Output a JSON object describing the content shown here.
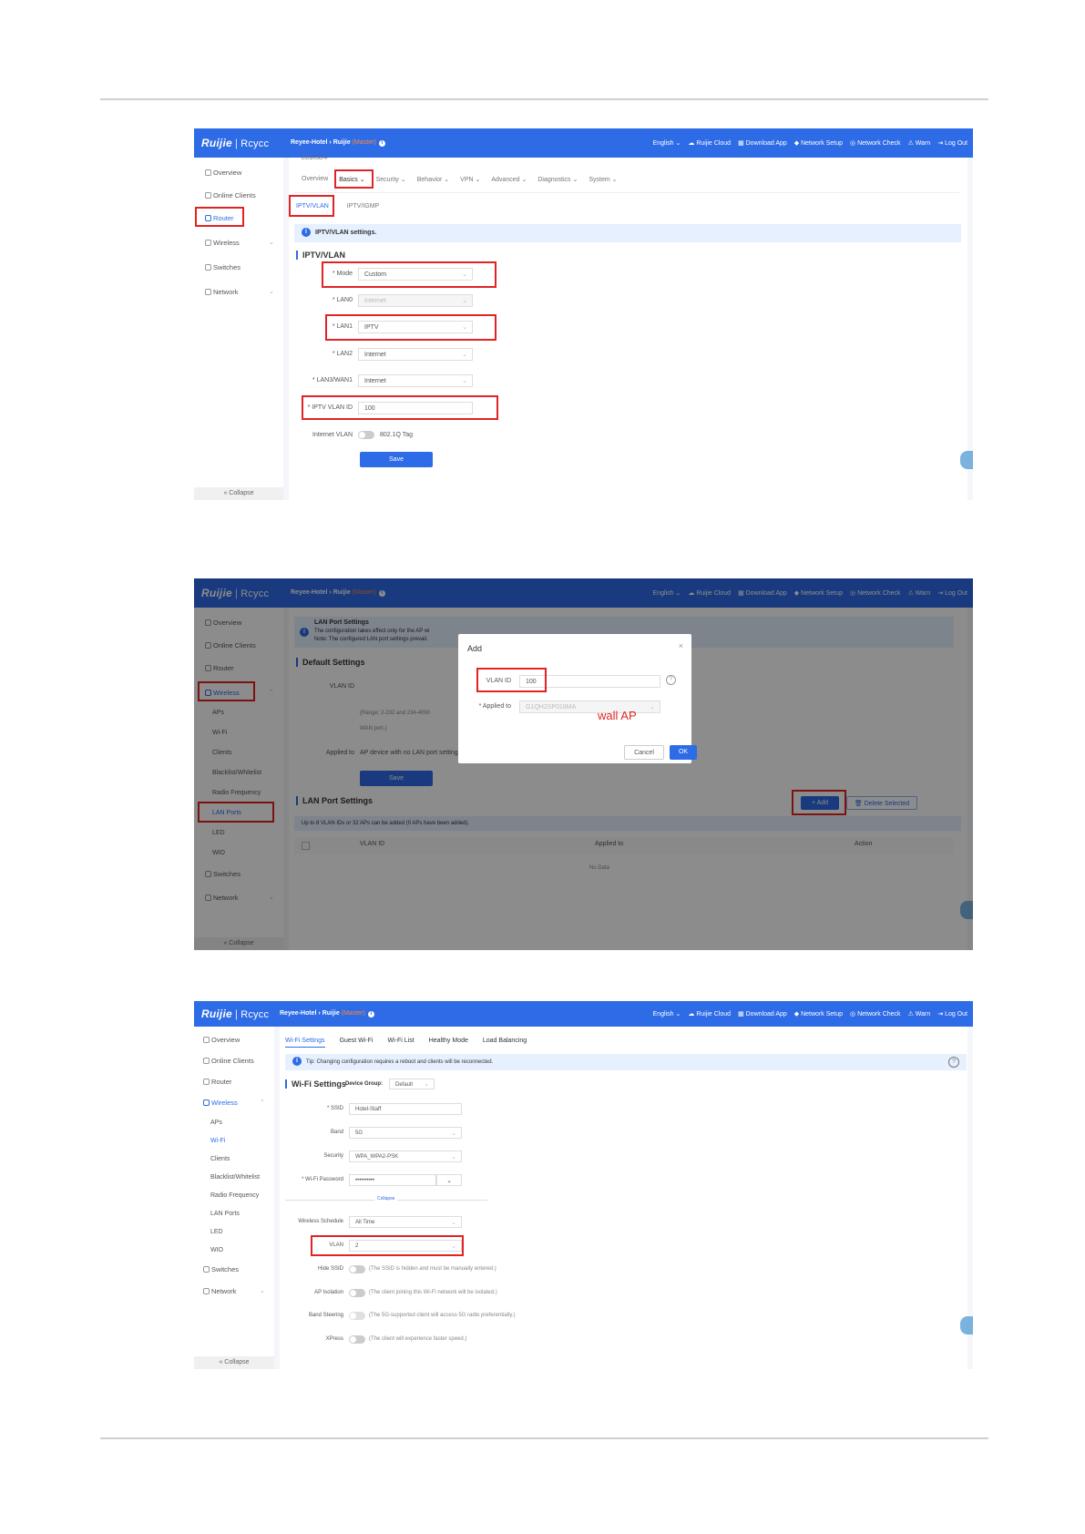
{
  "common": {
    "brand_ruijie": "Ruijie",
    "brand_reyee": "Rcycc",
    "crumb_site": "Reyee-Hotel",
    "crumb_device": "Ruijie",
    "crumb_master": "(Master)",
    "nav": [
      "English ⌄",
      "Ruijie Cloud",
      "Download App",
      "Network Setup",
      "Network Check",
      "Warn",
      "Log Out"
    ],
    "collapse": "Collapse"
  },
  "shot1": {
    "sidebar": [
      "Overview",
      "Online Clients",
      "Router",
      "Wireless",
      "Switches",
      "Network"
    ],
    "device_model": "EG105G-P",
    "tabs": [
      "Overview",
      "Basics ⌄",
      "Security ⌄",
      "Behavior ⌄",
      "VPN ⌄",
      "Advanced ⌄",
      "Diagnostics ⌄",
      "System ⌄"
    ],
    "subtabs": [
      "IPTV/VLAN",
      "IPTV/IGMP"
    ],
    "banner": "IPTV/VLAN settings.",
    "section": "IPTV/VLAN",
    "fields": [
      {
        "label": "* Mode",
        "value": "Custom"
      },
      {
        "label": "* LAN0",
        "value": "Internet"
      },
      {
        "label": "* LAN1",
        "value": "IPTV"
      },
      {
        "label": "* LAN2",
        "value": "Internet"
      },
      {
        "label": "* LAN3/WAN1",
        "value": "Internet"
      },
      {
        "label": "* IPTV VLAN ID",
        "value": "100"
      }
    ],
    "internet_vlan_label": "Internet VLAN",
    "tag_text": "802.1Q Tag",
    "save": "Save"
  },
  "shot2": {
    "sidebar": [
      "Overview",
      "Online Clients",
      "Router",
      "Wireless",
      "Switches",
      "Network"
    ],
    "sub": [
      "APs",
      "Wi-Fi",
      "Clients",
      "Blacklist/Whitelist",
      "Radio Frequency",
      "LAN Ports",
      "LED",
      "WIO"
    ],
    "banner_title": "LAN Port Settings",
    "banner_line1": "The configuration takes effect only for the AP wi",
    "banner_line2": "Note: The configured LAN port settings prevail.",
    "default_section": "Default Settings",
    "vlan_id_label": "VLAN ID",
    "range_hint": "(Range: 2-232 and 234-4090",
    "wan_hint": "WAN port.)",
    "applied_label": "Applied to",
    "applied_value": "AP device with no LAN port settings",
    "save": "Save",
    "lan_section": "LAN Port Settings",
    "add": "+ Add",
    "delete": "Delete Selected",
    "limit_hint": "Up to 8 VLAN IDs or 32 APs can be added (0 APs have been added).",
    "col_vlan": "VLAN ID",
    "col_applied": "Applied to",
    "col_action": "Action",
    "no_data": "No Data",
    "dialog": {
      "title": "Add",
      "vlan_label": "VLAN ID",
      "vlan_value": "100",
      "applied_label": "* Applied to",
      "applied_value": "G1QH2SP018MA",
      "annotation": "wall AP",
      "cancel": "Cancel",
      "ok": "OK"
    }
  },
  "shot3": {
    "sidebar": [
      "Overview",
      "Online Clients",
      "Router",
      "Wireless",
      "Switches",
      "Network"
    ],
    "sub": [
      "APs",
      "Wi-Fi",
      "Clients",
      "Blacklist/Whitelist",
      "Radio Frequency",
      "LAN Ports",
      "LED",
      "WIO"
    ],
    "tabs": [
      "Wi-Fi Settings",
      "Guest Wi-Fi",
      "Wi-Fi List",
      "Healthy Mode",
      "Load Balancing"
    ],
    "banner": "Tip: Changing configuration requires a reboot and clients will be reconnected.",
    "section": "Wi-Fi Settings",
    "group_label": "Device Group:",
    "group_value": "Default",
    "fields": [
      {
        "label": "* SSID",
        "value": "Hotel-Staff"
      },
      {
        "label": "Band",
        "value": "5G"
      },
      {
        "label": "Security",
        "value": "WPA_WPA2-PSK"
      },
      {
        "label": "* Wi-Fi Password",
        "value": "••••••••••"
      }
    ],
    "collapse_link": "Collapse",
    "schedule_label": "Wireless Schedule",
    "schedule_value": "All Time",
    "vlan_label": "VLAN",
    "vlan_value": "2",
    "toggles": [
      {
        "label": "Hide SSID",
        "hint": "(The SSID is hidden and must be manually entered.)"
      },
      {
        "label": "AP Isolation",
        "hint": "(The client joining this Wi-Fi network will be isolated.)"
      },
      {
        "label": "Band Steering",
        "hint": "(The 5G-supported client will access 5G radio preferentially.)"
      },
      {
        "label": "XPress",
        "hint": "(The client will experience faster speed.)"
      }
    ]
  }
}
